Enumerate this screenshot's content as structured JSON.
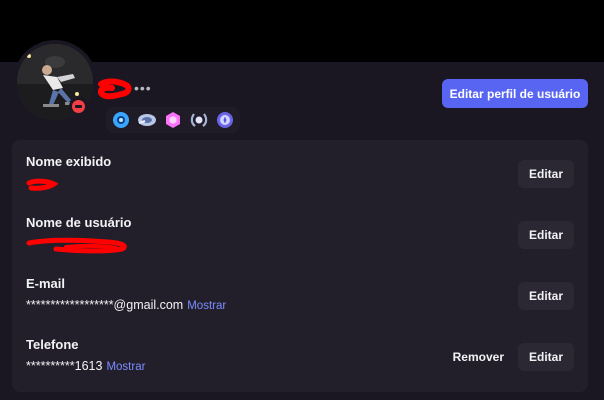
{
  "profile": {
    "more_label": "•••",
    "edit_profile_label": "Editar perfil de usuário",
    "badges": [
      "hypesquad-icon",
      "nitro-icon",
      "boost-icon",
      "laurel-icon",
      "quest-icon"
    ],
    "status": "do-not-disturb"
  },
  "account": {
    "display_name": {
      "label": "Nome exibido",
      "edit": "Editar"
    },
    "username": {
      "label": "Nome de usuário",
      "edit": "Editar"
    },
    "email": {
      "label": "E-mail",
      "value": "******************@gmail.com",
      "show": "Mostrar",
      "edit": "Editar"
    },
    "phone": {
      "label": "Telefone",
      "value": "**********1613",
      "show": "Mostrar",
      "remove": "Remover",
      "edit": "Editar"
    }
  },
  "colors": {
    "accent": "#5865f2",
    "link": "#7b8cff",
    "dnd": "#f23f43",
    "redaction": "#ff0000"
  }
}
